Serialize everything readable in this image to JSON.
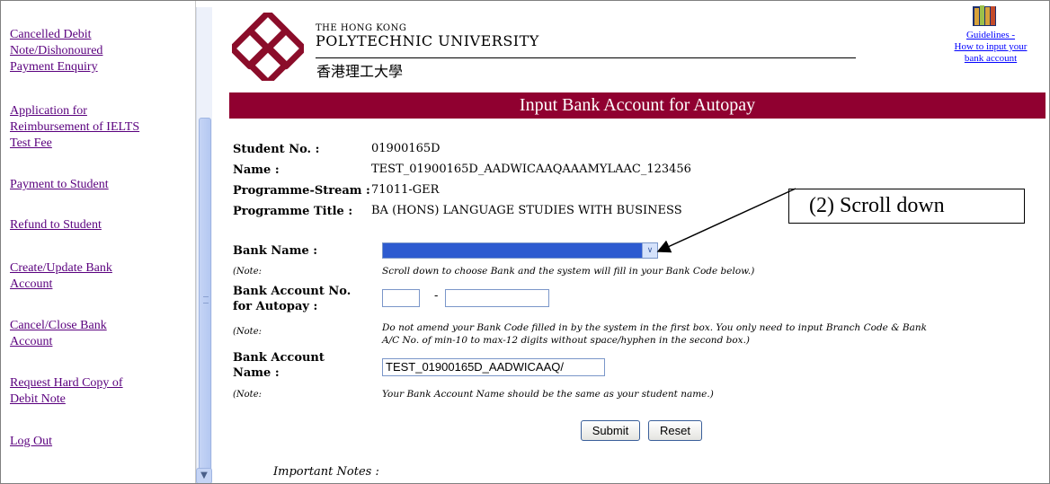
{
  "sidebar": {
    "items": [
      {
        "label": "Cancelled Debit\nNote/Dishonoured\nPayment Enquiry"
      },
      {
        "label": "Application for\nReimbursement of IELTS\nTest Fee"
      },
      {
        "label": "Payment to Student"
      },
      {
        "label": "Refund to Student"
      },
      {
        "label": "Create/Update Bank\nAccount"
      },
      {
        "label": "Cancel/Close Bank\nAccount"
      },
      {
        "label": "Request Hard Copy of\nDebit Note"
      },
      {
        "label": "Log Out"
      }
    ]
  },
  "header": {
    "uni_the": "THE HONG KONG",
    "uni_name": "POLYTECHNIC UNIVERSITY",
    "uni_name_zh": "香港理工大學",
    "guidelines_link": "Guidelines -\nHow to input your\nbank account"
  },
  "title": "Input Bank Account for Autopay",
  "student": {
    "no_label": "Student No. :",
    "no_value": "01900165D",
    "name_label": "Name :",
    "name_value": "TEST_01900165D_AADWICAAQAAAMYLAAC_123456",
    "prog_stream_label": "Programme-Stream :",
    "prog_stream_value": "71011-GER",
    "prog_title_label": "Programme Title :",
    "prog_title_value": "BA (HONS) LANGUAGE STUDIES WITH BUSINESS"
  },
  "form": {
    "bank_name_label": "Bank Name :",
    "note_label": "(Note:",
    "bank_name_note": "Scroll down to choose Bank and the system will fill in your Bank Code below.)",
    "acct_no_label": "Bank Account No.\nfor Autopay :",
    "acct_dash": "-",
    "acct_no_note": "Do not amend your Bank Code filled in by the system in the first box. You only need to input Branch Code & Bank\nA/C No. of min-10 to max-12 digits without space/hyphen in the second box.)",
    "acct_name_label": "Bank Account\nName :",
    "acct_name_value": "TEST_01900165D_AADWICAAQ/",
    "acct_name_note": "Your Bank Account Name should be the same as your student name.)",
    "submit": "Submit",
    "reset": "Reset",
    "important_notes": "Important Notes :"
  },
  "callout": {
    "text": "(2) Scroll down"
  },
  "colors": {
    "title_bar": "#900030",
    "link_visited": "#5a007e",
    "link": "#0000ff",
    "select_highlight": "#2d5bd0"
  },
  "icons": [
    "books-icon",
    "chevron-down-icon",
    "scroll-down-arrow-icon",
    "polyu-logo"
  ]
}
